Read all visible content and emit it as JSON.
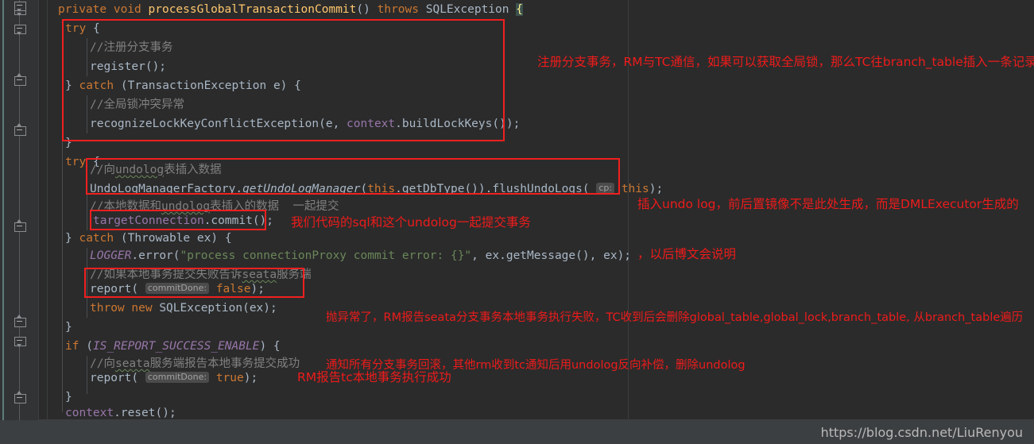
{
  "editor": {
    "theme_background": "#2b2b2b",
    "gutter_background": "#313335",
    "annotation_color": "#ee1b1b",
    "lines": [
      {
        "id": "l1",
        "text": "private void processGlobalTransactionCommit() throws SQLException {"
      },
      {
        "id": "l2",
        "text": "try {"
      },
      {
        "id": "l3",
        "text": "//注册分支事务"
      },
      {
        "id": "l4",
        "text": "register();"
      },
      {
        "id": "l5",
        "text": "} catch (TransactionException e) {"
      },
      {
        "id": "l6",
        "text": "//全局锁冲突异常"
      },
      {
        "id": "l7",
        "text": "recognizeLockKeyConflictException(e, context.buildLockKeys());"
      },
      {
        "id": "l8",
        "text": "}"
      },
      {
        "id": "l9",
        "text": "try {"
      },
      {
        "id": "l10",
        "text": "//向undolog表插入数据"
      },
      {
        "id": "l11",
        "text": "UndoLogManagerFactory.getUndoLogManager(this.getDbType()).flushUndoLogs( cp: this);"
      },
      {
        "id": "l12",
        "text": "//本地数据和undolog表插入的数据  一起提交"
      },
      {
        "id": "l13",
        "text": "targetConnection.commit();"
      },
      {
        "id": "l14",
        "text": "} catch (Throwable ex) {"
      },
      {
        "id": "l15",
        "text": "LOGGER.error(\"process connectionProxy commit error: {}\", ex.getMessage(), ex);"
      },
      {
        "id": "l16",
        "text": "//如果本地事务提交失败告诉seata服务端"
      },
      {
        "id": "l17",
        "text": "report( commitDone: false);"
      },
      {
        "id": "l18",
        "text": "throw new SQLException(ex);"
      },
      {
        "id": "l19",
        "text": "}"
      },
      {
        "id": "l20",
        "text": "if (IS_REPORT_SUCCESS_ENABLE) {"
      },
      {
        "id": "l21",
        "text": "//向seata服务端报告本地事务提交成功"
      },
      {
        "id": "l22",
        "text": "report( commitDone: true);"
      },
      {
        "id": "l23",
        "text": "}"
      },
      {
        "id": "l24",
        "text": "context.reset();"
      },
      {
        "id": "l25",
        "text": "}"
      }
    ],
    "tokens": {
      "kw_private": "private",
      "kw_void": "void",
      "method_name": "processGlobalTransactionCommit",
      "kw_throws": "throws",
      "type_sqlexception": "SQLException",
      "kw_try": "try",
      "kw_catch": "catch",
      "kw_new": "new",
      "kw_if": "if",
      "kw_throw": "throw",
      "kw_this": "this",
      "kw_false": "false",
      "kw_true": "true",
      "comment_register_branch": "//注册分支事务",
      "comment_global_lock": "//全局锁冲突异常",
      "comment_insert_undolog": "//向undolog表插入数据",
      "comment_local_and_undolog": "//本地数据和undolog表插入的数据",
      "comment_local_and_undolog_tail": "一起提交",
      "comment_fail_report": "//如果本地事务提交失败告诉seata服务端",
      "comment_success_report": "//向seata服务端报告本地事务提交成功",
      "string_logger": "\"process connectionProxy commit error: {}\"",
      "field_logger": "LOGGER",
      "field_flag": "IS_REPORT_SUCCESS_ENABLE",
      "param_hint_cp": "cp:",
      "param_hint_commitdone": "commitDone:"
    }
  },
  "annotations": [
    {
      "id": "a1",
      "text": "注册分支事务，RM与TC通信，如果可以获取全局锁，那么TC往branch_table插入一条记录"
    },
    {
      "id": "a2",
      "line1": "插入undo log，前后置镜像不是此处生成，而是DMLExecutor生成的",
      "line2": "，以后博文会说明"
    },
    {
      "id": "a3",
      "text": "我们代码的sql和这个undolog一起提交事务"
    },
    {
      "id": "a4",
      "line1": "抛异常了，RM报告seata分支事务本地事务执行失败，TC收到后会删除global_table,global_lock,branch_table, 从branch_table遍历",
      "line2": "通知所有分支事务回滚，其他rm收到tc通知后用undolog反向补偿，删除undolog"
    },
    {
      "id": "a5",
      "text": "RM报告tc本地事务执行成功"
    }
  ],
  "status_bar": {
    "watermark": "https://blog.csdn.net/LiuRenyou"
  }
}
